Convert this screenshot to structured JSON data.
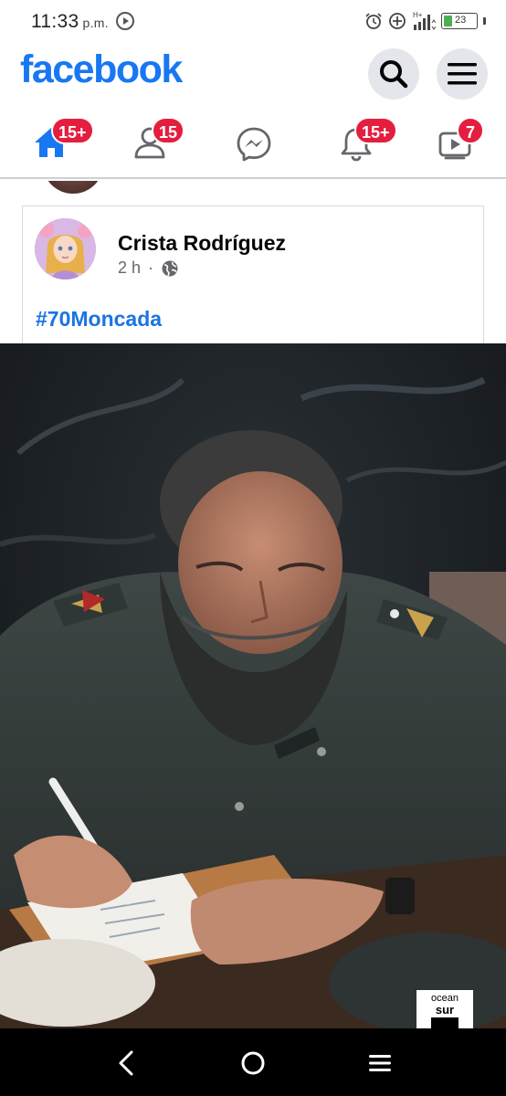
{
  "status_bar": {
    "time": "11:33",
    "ampm": "p.m.",
    "battery_level": "23",
    "network": "H+"
  },
  "header": {
    "logo": "facebook",
    "search_icon": "search-icon",
    "menu_icon": "menu-icon"
  },
  "nav": {
    "tabs": [
      {
        "name": "home",
        "icon": "home-icon",
        "badge": "15+",
        "active": true
      },
      {
        "name": "friends",
        "icon": "friends-icon",
        "badge": "15",
        "active": false
      },
      {
        "name": "messenger",
        "icon": "messenger-icon",
        "badge": "",
        "active": false
      },
      {
        "name": "notifications",
        "icon": "bell-icon",
        "badge": "15+",
        "active": false
      },
      {
        "name": "watch",
        "icon": "video-icon",
        "badge": "7",
        "active": false
      }
    ]
  },
  "post": {
    "author": "Crista Rodríguez",
    "time": "2 h",
    "separator": "·",
    "audience_icon": "globe-icon",
    "text": "#70Moncada",
    "photo_watermark_line1": "ocean",
    "photo_watermark_line2": "sur"
  },
  "colors": {
    "brand": "#1877f2",
    "badge": "#e41e3f",
    "hashtag": "#1b74e4"
  }
}
